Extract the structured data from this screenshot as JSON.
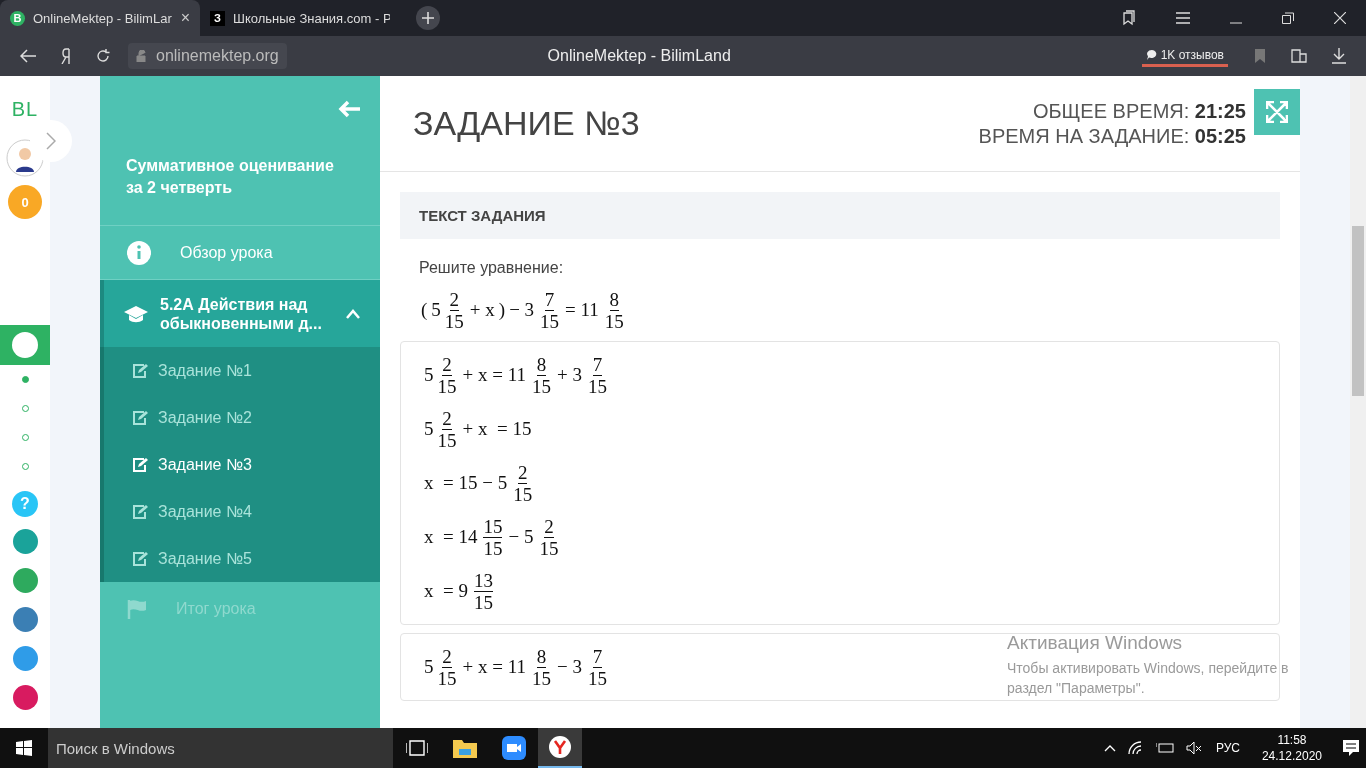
{
  "browser": {
    "tabs": [
      {
        "title": "OnlineMektep - BilimLar",
        "selected": true,
        "close": "×",
        "badge": "B"
      },
      {
        "title": "Школьные Знания.com - Р",
        "selected": false,
        "badge": "З"
      }
    ],
    "address": "onlinemektep.org",
    "page_title": "OnlineMektep - BilimLand",
    "reviews": "1K отзывов"
  },
  "rail": {
    "logo": "BL",
    "points": "0",
    "help": "?",
    "steps": [
      {
        "selected": true
      },
      {
        "selected": false
      },
      {
        "selected": false
      },
      {
        "selected": false
      }
    ]
  },
  "sidebar": {
    "title": "Суммативное оценивание за 2 четверть",
    "overview": "Обзор урока",
    "lesson": {
      "title": "5.2А Действия над обыкновенными д...",
      "expanded": true
    },
    "tasks": [
      {
        "label": "Задание №1",
        "selected": false
      },
      {
        "label": "Задание №2",
        "selected": false
      },
      {
        "label": "Задание №3",
        "selected": true
      },
      {
        "label": "Задание №4",
        "selected": false
      },
      {
        "label": "Задание №5",
        "selected": false
      }
    ],
    "summary": {
      "label": "Итог урока",
      "disabled": true
    }
  },
  "task": {
    "title": "ЗАДАНИЕ №3",
    "total_time_label": "ОБЩЕЕ ВРЕМЯ:",
    "total_time": "21:25",
    "task_time_label": "ВРЕМЯ НА ЗАДАНИЕ:",
    "task_time": "05:25",
    "section": "ТЕКСТ ЗАДАНИЯ",
    "prompt": "Решите уравнение:",
    "equation": [
      {
        "kind": "text",
        "text": "("
      },
      {
        "kind": "frac",
        "whole": "5",
        "num": "2",
        "den": "15"
      },
      {
        "kind": "text",
        "text": "+ x"
      },
      {
        "kind": "text",
        "text": ")"
      },
      {
        "kind": "text",
        "text": "− 3"
      },
      {
        "kind": "frac",
        "num": "7",
        "den": "15"
      },
      {
        "kind": "text",
        "text": "= 11"
      },
      {
        "kind": "frac",
        "num": "8",
        "den": "15"
      }
    ],
    "answers": [
      [
        [
          {
            "kind": "frac",
            "whole": "5",
            "num": "2",
            "den": "15"
          },
          {
            "kind": "text",
            "text": "+ x = 11"
          },
          {
            "kind": "frac",
            "num": "8",
            "den": "15"
          },
          {
            "kind": "text",
            "text": "+ 3"
          },
          {
            "kind": "frac",
            "num": "7",
            "den": "15"
          }
        ],
        [
          {
            "kind": "frac",
            "whole": "5",
            "num": "2",
            "den": "15"
          },
          {
            "kind": "text",
            "text": "+ x  = 15"
          }
        ],
        [
          {
            "kind": "text",
            "text": "x  = 15 − 5"
          },
          {
            "kind": "frac",
            "num": "2",
            "den": "15"
          }
        ],
        [
          {
            "kind": "text",
            "text": "x  = 14"
          },
          {
            "kind": "frac",
            "num": "15",
            "den": "15"
          },
          {
            "kind": "text",
            "text": "− 5"
          },
          {
            "kind": "frac",
            "num": "2",
            "den": "15"
          }
        ],
        [
          {
            "kind": "text",
            "text": "x  = 9"
          },
          {
            "kind": "frac",
            "num": "13",
            "den": "15"
          }
        ]
      ],
      [
        [
          {
            "kind": "frac",
            "whole": "5",
            "num": "2",
            "den": "15"
          },
          {
            "kind": "text",
            "text": "+ x = 11"
          },
          {
            "kind": "frac",
            "num": "8",
            "den": "15"
          },
          {
            "kind": "text",
            "text": "− 3"
          },
          {
            "kind": "frac",
            "num": "7",
            "den": "15"
          }
        ]
      ]
    ]
  },
  "activation": {
    "title": "Активация Windows",
    "text": "Чтобы активировать Windows, перейдите в раздел \"Параметры\"."
  },
  "taskbar": {
    "search": "Поиск в Windows",
    "lang": "РУС",
    "time": "11:58",
    "date": "24.12.2020"
  }
}
